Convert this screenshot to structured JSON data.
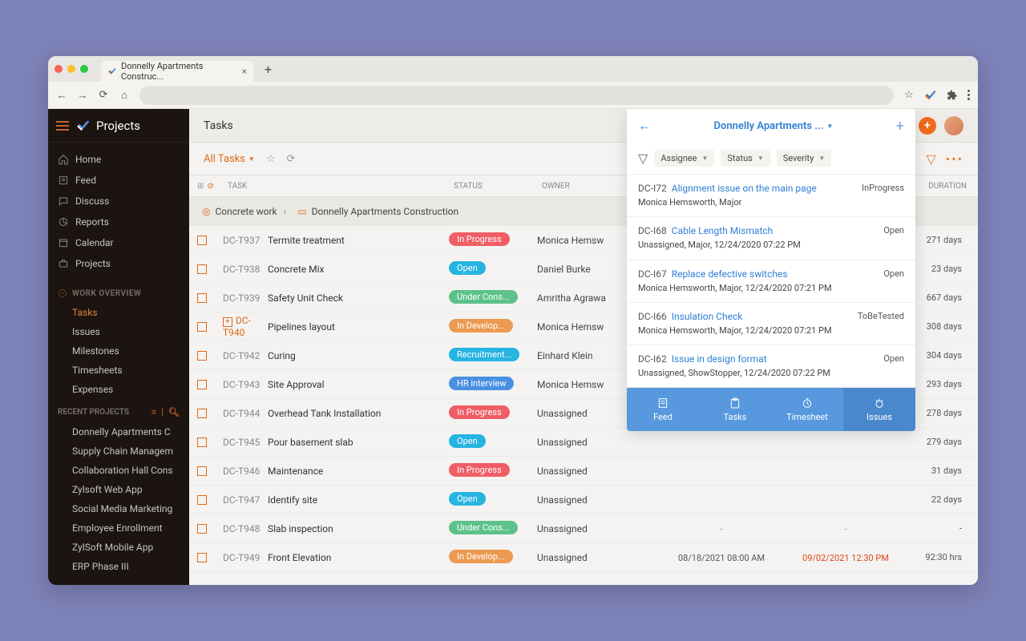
{
  "browser": {
    "tab_title": "Donnelly Apartments Construc...",
    "star_title": "★"
  },
  "sidebar": {
    "brand": "Projects",
    "main_nav": [
      {
        "icon": "home",
        "label": "Home"
      },
      {
        "icon": "feed",
        "label": "Feed"
      },
      {
        "icon": "chat",
        "label": "Discuss"
      },
      {
        "icon": "report",
        "label": "Reports"
      },
      {
        "icon": "calendar",
        "label": "Calendar"
      },
      {
        "icon": "briefcase",
        "label": "Projects"
      }
    ],
    "work_overview_label": "WORK OVERVIEW",
    "work_items": [
      {
        "label": "Tasks",
        "active": true
      },
      {
        "label": "Issues"
      },
      {
        "label": "Milestones"
      },
      {
        "label": "Timesheets"
      },
      {
        "label": "Expenses"
      }
    ],
    "recent_label": "RECENT PROJECTS",
    "recent": [
      "Donnelly Apartments C",
      "Supply Chain Managem",
      "Collaboration Hall Cons",
      "Zylsoft Web App",
      "Social Media Marketing",
      "Employee Enrollment",
      "ZylSoft Mobile App",
      "ERP Phase III"
    ]
  },
  "header": {
    "title": "Tasks"
  },
  "toolbar": {
    "all_tasks": "All Tasks"
  },
  "columns": {
    "task": "TASK",
    "status": "STATUS",
    "owner": "OWNER",
    "duration": "DURATION"
  },
  "breadcrumb": {
    "parent": "Concrete work",
    "current": "Donnelly Apartments Construction"
  },
  "status_colors": {
    "In Progress": "#ef5d65",
    "Open": "#26b4e0",
    "Under Cons...": "#5dc28a",
    "In Develop...": "#ec9a51",
    "Recruitment...": "#26b4e0",
    "HR interview": "#4a90e2"
  },
  "tasks": [
    {
      "id": "DC-T937",
      "name": "Termite treatment",
      "status": "In Progress",
      "owner": "Monica Hemsw",
      "duration": "271 days"
    },
    {
      "id": "DC-T938",
      "name": "Concrete Mix",
      "status": "Open",
      "owner": "Daniel Burke",
      "duration": "23 days"
    },
    {
      "id": "DC-T939",
      "name": "Safety Unit Check",
      "status": "Under Cons...",
      "owner": "Amritha Agrawa",
      "duration": "667 days"
    },
    {
      "id": "DC-T940",
      "name": "Pipelines layout",
      "status": "In Develop...",
      "owner": "Monica Hemsw",
      "hasSub": true,
      "duration": "308 days"
    },
    {
      "id": "DC-T942",
      "name": "Curing",
      "status": "Recruitment...",
      "owner": "Einhard Klein",
      "duration": "304 days"
    },
    {
      "id": "DC-T943",
      "name": "Site Approval",
      "status": "HR interview",
      "owner": "Monica Hemsw",
      "duration": "293 days"
    },
    {
      "id": "DC-T944",
      "name": "Overhead Tank Installation",
      "status": "In Progress",
      "owner": "Unassigned",
      "duration": "278 days"
    },
    {
      "id": "DC-T945",
      "name": "Pour basement slab",
      "status": "Open",
      "owner": "Unassigned",
      "duration": "279 days"
    },
    {
      "id": "DC-T946",
      "name": "Maintenance",
      "status": "In Progress",
      "owner": "Unassigned",
      "duration": "31 days"
    },
    {
      "id": "DC-T947",
      "name": "Identify site",
      "status": "Open",
      "owner": "Unassigned",
      "duration": "22 days"
    },
    {
      "id": "DC-T948",
      "name": "Slab inspection",
      "status": "Under Cons...",
      "owner": "Unassigned",
      "start": "-",
      "end": "-",
      "duration": "-"
    },
    {
      "id": "DC-T949",
      "name": "Front Elevation",
      "status": "In Develop...",
      "owner": "Unassigned",
      "start": "08/18/2021 08:00 AM",
      "end": "09/02/2021 12:30 PM",
      "end_overdue": true,
      "duration": "92:30 hrs"
    }
  ],
  "popup": {
    "title": "Donnelly Apartments ...",
    "filters": [
      "Assignee",
      "Status",
      "Severity"
    ],
    "issues": [
      {
        "id": "DC-I72",
        "title": "Alignment issue on the main page",
        "meta": "Monica Hemsworth, Major",
        "status": "InProgress"
      },
      {
        "id": "DC-I68",
        "title": "Cable Length Mismatch",
        "meta": "Unassigned, Major, 12/24/2020 07:22 PM",
        "status": "Open"
      },
      {
        "id": "DC-I67",
        "title": "Replace defective switches",
        "meta": "Monica Hemsworth, Major, 12/24/2020 07:21 PM",
        "status": "Open"
      },
      {
        "id": "DC-I66",
        "title": "Insulation Check",
        "meta": "Monica Hemsworth, Major, 12/24/2020 07:21 PM",
        "status": "ToBeTested"
      },
      {
        "id": "DC-I62",
        "title": "Issue in design format",
        "meta": "Unassigned, ShowStopper, 12/24/2020 07:22 PM",
        "status": "Open"
      }
    ],
    "tabs": [
      {
        "icon": "feed",
        "label": "Feed"
      },
      {
        "icon": "tasks",
        "label": "Tasks"
      },
      {
        "icon": "timesheet",
        "label": "Timesheet"
      },
      {
        "icon": "issues",
        "label": "Issues",
        "active": true
      }
    ]
  }
}
